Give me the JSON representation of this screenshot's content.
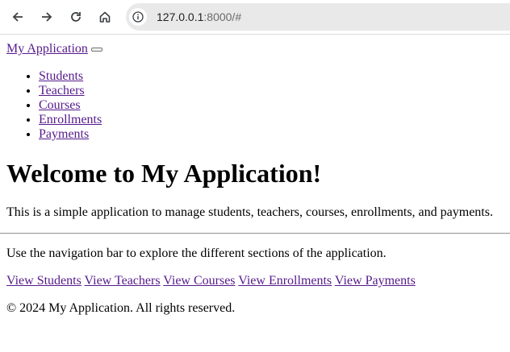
{
  "browser": {
    "url_host": "127.0.0.1",
    "url_rest": ":8000/#"
  },
  "navbar": {
    "brand": "My Application",
    "items": [
      {
        "label": "Students"
      },
      {
        "label": "Teachers"
      },
      {
        "label": "Courses"
      },
      {
        "label": "Enrollments"
      },
      {
        "label": "Payments"
      }
    ]
  },
  "main": {
    "heading": "Welcome to My Application!",
    "description": "This is a simple application to manage students, teachers, courses, enrollments, and payments.",
    "note": "Use the navigation bar to explore the different sections of the application.",
    "links": [
      {
        "label": "View Students"
      },
      {
        "label": "View Teachers"
      },
      {
        "label": "View Courses"
      },
      {
        "label": "View Enrollments"
      },
      {
        "label": "View Payments"
      }
    ]
  },
  "footer": {
    "text": "© 2024 My Application. All rights reserved."
  }
}
